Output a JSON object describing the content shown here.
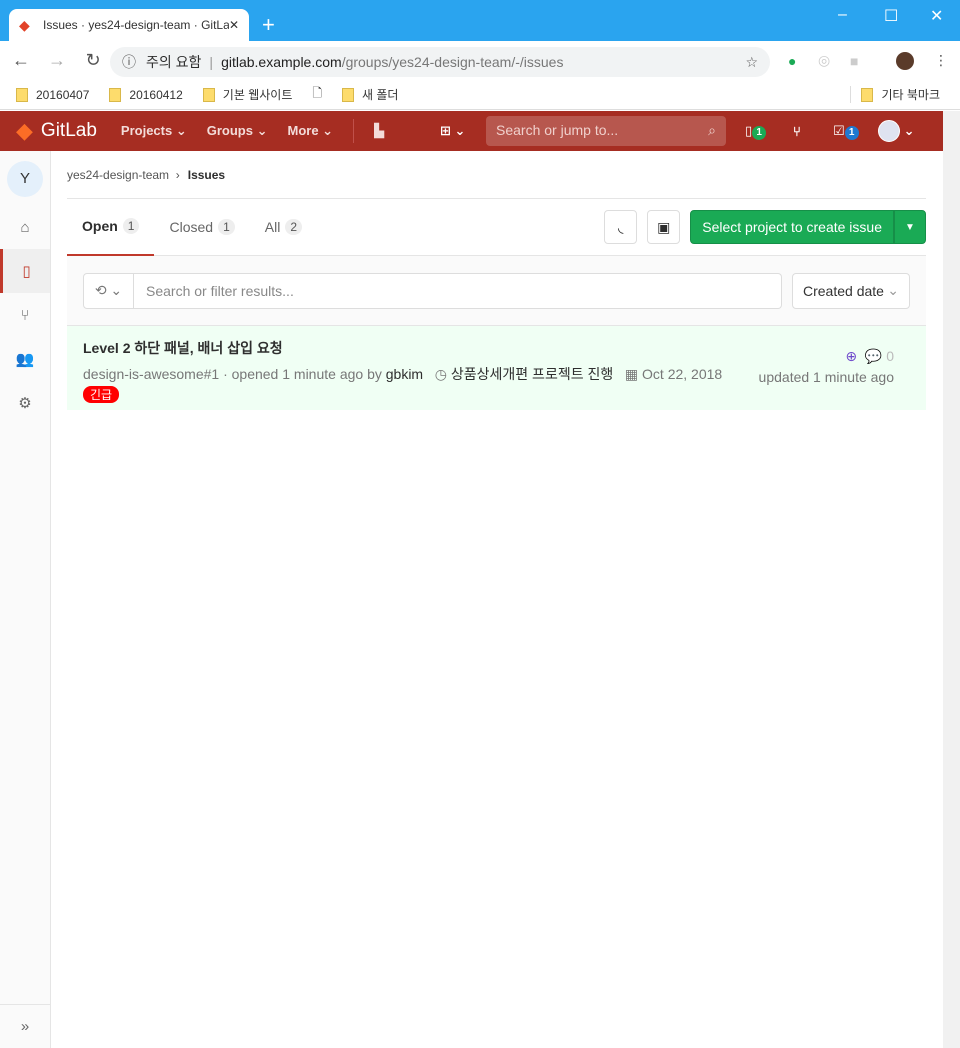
{
  "browser": {
    "tab_title": "Issues · yes24-design-team · GitLab",
    "url_warning": "주의 요함",
    "url_host": "gitlab.example.com",
    "url_path": "/groups/yes24-design-team/-/issues",
    "bookmarks": [
      "20160407",
      "20160412",
      "기본 웹사이트",
      "새 폴더"
    ],
    "other_bookmarks": "기타 북마크"
  },
  "nav": {
    "brand": "GitLab",
    "projects": "Projects",
    "groups": "Groups",
    "more": "More",
    "search_placeholder": "Search or jump to...",
    "issues_count": "1",
    "todos_count": "1"
  },
  "sidebar": {
    "avatar_letter": "Y"
  },
  "breadcrumb": {
    "group": "yes24-design-team",
    "current": "Issues"
  },
  "tabs": [
    {
      "label": "Open",
      "count": "1"
    },
    {
      "label": "Closed",
      "count": "1"
    },
    {
      "label": "All",
      "count": "2"
    }
  ],
  "actions": {
    "create": "Select project to create issue"
  },
  "filter": {
    "placeholder": "Search or filter results...",
    "sort": "Created date"
  },
  "issue": {
    "title": "Level 2 하단 패널, 배너 삽입 요청",
    "ref": "design-is-awesome#1",
    "opened": " · opened 1 minute ago by ",
    "author": "gbkim",
    "milestone": "상품상세개편 프로젝트 진행",
    "due": "Oct 22, 2018",
    "label": "긴급",
    "label_color": "#ff0000",
    "comments": "0",
    "updated": "updated 1 minute ago"
  },
  "colors": {
    "nav": "#a62d22",
    "accent": "#1aaa55"
  }
}
